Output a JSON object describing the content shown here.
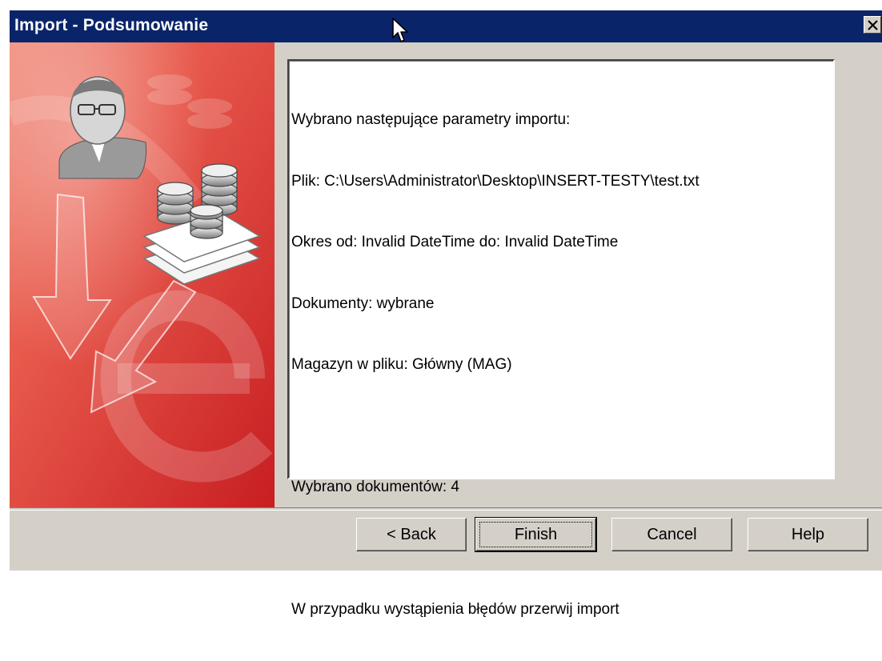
{
  "window": {
    "title": "Import - Podsumowanie",
    "close_icon": "close-icon"
  },
  "summary": {
    "lines": [
      "Wybrano następujące parametry importu:",
      "Plik: C:\\Users\\Administrator\\Desktop\\INSERT-TESTY\\test.txt",
      "Okres od: Invalid DateTime do: Invalid DateTime",
      "Dokumenty: wybrane",
      "Magazyn w pliku: Główny (MAG)",
      "",
      "Wybrano dokumentów: 4",
      "",
      "W przypadku wystąpienia błędów przerwij import"
    ]
  },
  "buttons": {
    "back": "< Back",
    "finish": "Finish",
    "cancel": "Cancel",
    "help": "Help"
  },
  "colors": {
    "title_bar": "#0a246a",
    "dialog_bg": "#d4d0c8",
    "side_red": "#d83a3a"
  }
}
